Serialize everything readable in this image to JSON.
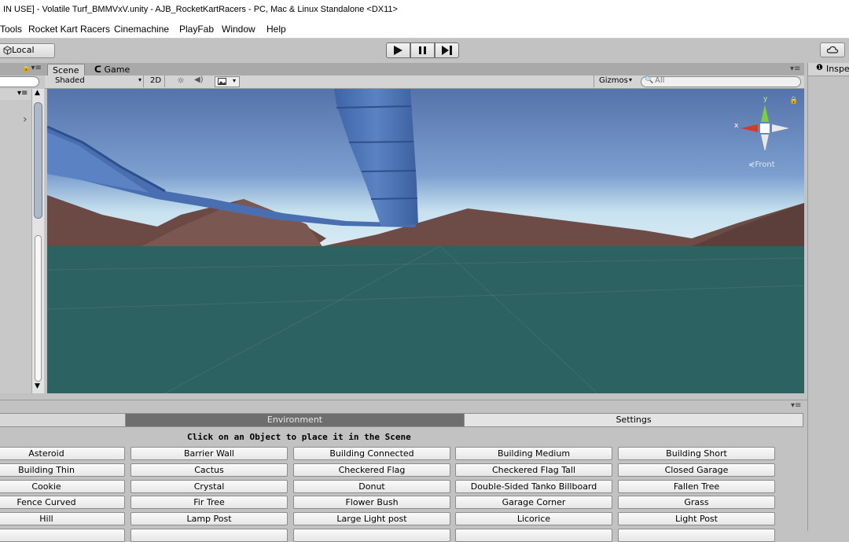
{
  "window": {
    "title": "IN USE] - Volatile Turf_BMMVxV.unity - AJB_RocketKartRacers - PC, Mac & Linux Standalone <DX11>"
  },
  "menu": [
    "Tools",
    "Rocket Kart Racers",
    "Cinemachine",
    "PlayFab",
    "Window",
    "Help"
  ],
  "toolbar": {
    "local_label": "Local"
  },
  "scene_tabs": {
    "scene": "Scene",
    "game": "Game"
  },
  "scene_toolbar": {
    "shading": "Shaded",
    "mode_2d": "2D",
    "gizmos": "Gizmos",
    "search_placeholder": "All"
  },
  "gizmo": {
    "y": "y",
    "x": "x",
    "view": "Front"
  },
  "inspector": {
    "tab": "Inspe"
  },
  "bottom": {
    "tabs": [
      "Environment",
      "Settings"
    ],
    "instruction": "Click on an Object to place it in the Scene",
    "objects": [
      "Asteroid",
      "Barrier Wall",
      "Building Connected",
      "Building Medium",
      "Building Short",
      "Building Thin",
      "Cactus",
      "Checkered Flag",
      "Checkered Flag Tall",
      "Closed Garage",
      "Cookie",
      "Crystal",
      "Donut",
      "Double-Sided Tanko Billboard",
      "Fallen Tree",
      "Fence Curved",
      "Fir Tree",
      "Flower Bush",
      "Garage Corner",
      "Grass",
      "Hill",
      "Lamp Post",
      "Large Light post",
      "Licorice",
      "Light Post"
    ]
  },
  "colors": {
    "sky_top": "#4f6fa8",
    "sky_horizon": "#c9e2ef",
    "ground": "#2d6262",
    "mountains": "#6e4a44",
    "track": "#4e74b6"
  }
}
